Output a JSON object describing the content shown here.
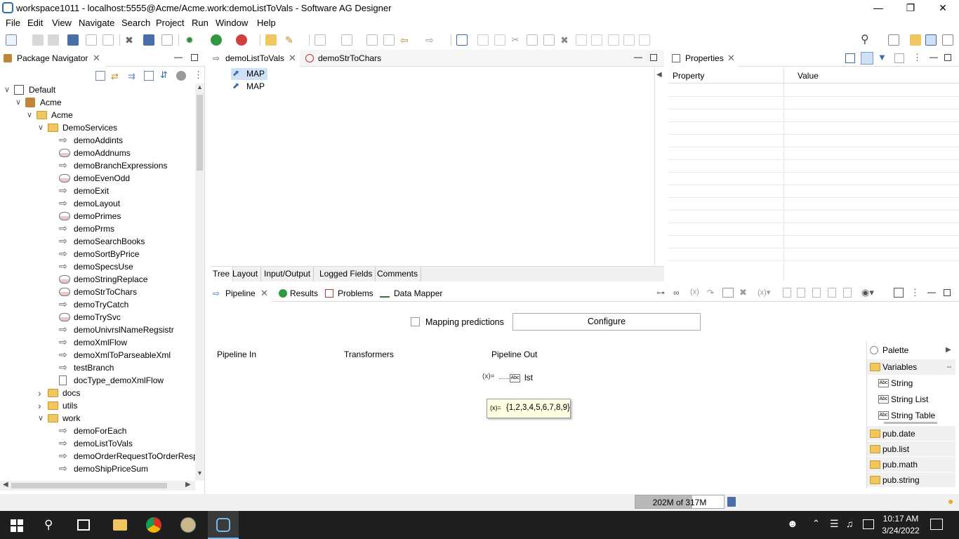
{
  "window": {
    "title": "workspace1011 - localhost:5555@Acme/Acme.work:demoListToVals - Software AG Designer"
  },
  "menu": [
    "File",
    "Edit",
    "View",
    "Navigate",
    "Search",
    "Project",
    "Run",
    "Window",
    "Help"
  ],
  "navigator": {
    "tab_label": "Package Navigator",
    "tree": [
      {
        "label": "Default",
        "level": 0,
        "kind": "server",
        "expanded": true
      },
      {
        "label": "Acme",
        "level": 1,
        "kind": "package",
        "expanded": true
      },
      {
        "label": "Acme",
        "level": 2,
        "kind": "folder",
        "expanded": true
      },
      {
        "label": "DemoServices",
        "level": 3,
        "kind": "folder",
        "expanded": true
      },
      {
        "label": "demoAddints",
        "level": 4,
        "kind": "flow"
      },
      {
        "label": "demoAddnums",
        "level": 4,
        "kind": "java"
      },
      {
        "label": "demoBranchExpressions",
        "level": 4,
        "kind": "flow"
      },
      {
        "label": "demoEvenOdd",
        "level": 4,
        "kind": "java"
      },
      {
        "label": "demoExit",
        "level": 4,
        "kind": "flow"
      },
      {
        "label": "demoLayout",
        "level": 4,
        "kind": "flow"
      },
      {
        "label": "demoPrimes",
        "level": 4,
        "kind": "java"
      },
      {
        "label": "demoPrms",
        "level": 4,
        "kind": "flow"
      },
      {
        "label": "demoSearchBooks",
        "level": 4,
        "kind": "flow"
      },
      {
        "label": "demoSortByPrice",
        "level": 4,
        "kind": "flow"
      },
      {
        "label": "demoSpecsUse",
        "level": 4,
        "kind": "flow"
      },
      {
        "label": "demoStringReplace",
        "level": 4,
        "kind": "java"
      },
      {
        "label": "demoStrToChars",
        "level": 4,
        "kind": "java"
      },
      {
        "label": "demoTryCatch",
        "level": 4,
        "kind": "flow"
      },
      {
        "label": "demoTrySvc",
        "level": 4,
        "kind": "java"
      },
      {
        "label": "demoUnivrslNameRegsistr",
        "level": 4,
        "kind": "flow"
      },
      {
        "label": "demoXmlFlow",
        "level": 4,
        "kind": "flow"
      },
      {
        "label": "demoXmlToParseableXml",
        "level": 4,
        "kind": "flow"
      },
      {
        "label": "testBranch",
        "level": 4,
        "kind": "flow"
      },
      {
        "label": "docType_demoXmlFlow",
        "level": 4,
        "kind": "doc"
      },
      {
        "label": "docs",
        "level": 3,
        "kind": "folder",
        "expanded": false
      },
      {
        "label": "utils",
        "level": 3,
        "kind": "folder",
        "expanded": false
      },
      {
        "label": "work",
        "level": 3,
        "kind": "folder",
        "expanded": true
      },
      {
        "label": "demoForEach",
        "level": 4,
        "kind": "flow"
      },
      {
        "label": "demoListToVals",
        "level": 4,
        "kind": "flow"
      },
      {
        "label": "demoOrderRequestToOrderResp",
        "level": 4,
        "kind": "flow"
      },
      {
        "label": "demoShipPriceSum",
        "level": 4,
        "kind": "flow"
      }
    ]
  },
  "editor": {
    "tabs": [
      {
        "label": "demoListToVals",
        "active": true
      },
      {
        "label": "demoStrToChars",
        "active": false
      }
    ],
    "steps": [
      "MAP",
      "MAP"
    ],
    "bottom_tabs": [
      "Tree",
      "Layout",
      "Input/Output",
      "Logged Fields",
      "Comments"
    ]
  },
  "properties": {
    "tab_label": "Properties",
    "col_property": "Property",
    "col_value": "Value"
  },
  "pipeline": {
    "tabs": [
      "Pipeline",
      "Results",
      "Problems",
      "Data Mapper"
    ],
    "mapping_predictions": "Mapping predictions",
    "configure": "Configure",
    "col_in": "Pipeline In",
    "col_transformers": "Transformers",
    "col_out": "Pipeline Out",
    "out_var": "lst",
    "tooltip_value": "{1,2,3,4,5,6,7,8,9}"
  },
  "palette": {
    "title": "Palette",
    "variables_label": "Variables",
    "items": [
      "String",
      "String List",
      "String Table"
    ],
    "folders": [
      "pub.date",
      "pub.list",
      "pub.math",
      "pub.string"
    ]
  },
  "status": {
    "heap": "202M of 317M",
    "heap_fraction": 0.64
  },
  "taskbar": {
    "time": "10:17 AM",
    "date": "3/24/2022"
  },
  "colors": {
    "accent": "#2f6db3",
    "folder": "#f0c75e",
    "taskbar": "#1f1f1f"
  }
}
